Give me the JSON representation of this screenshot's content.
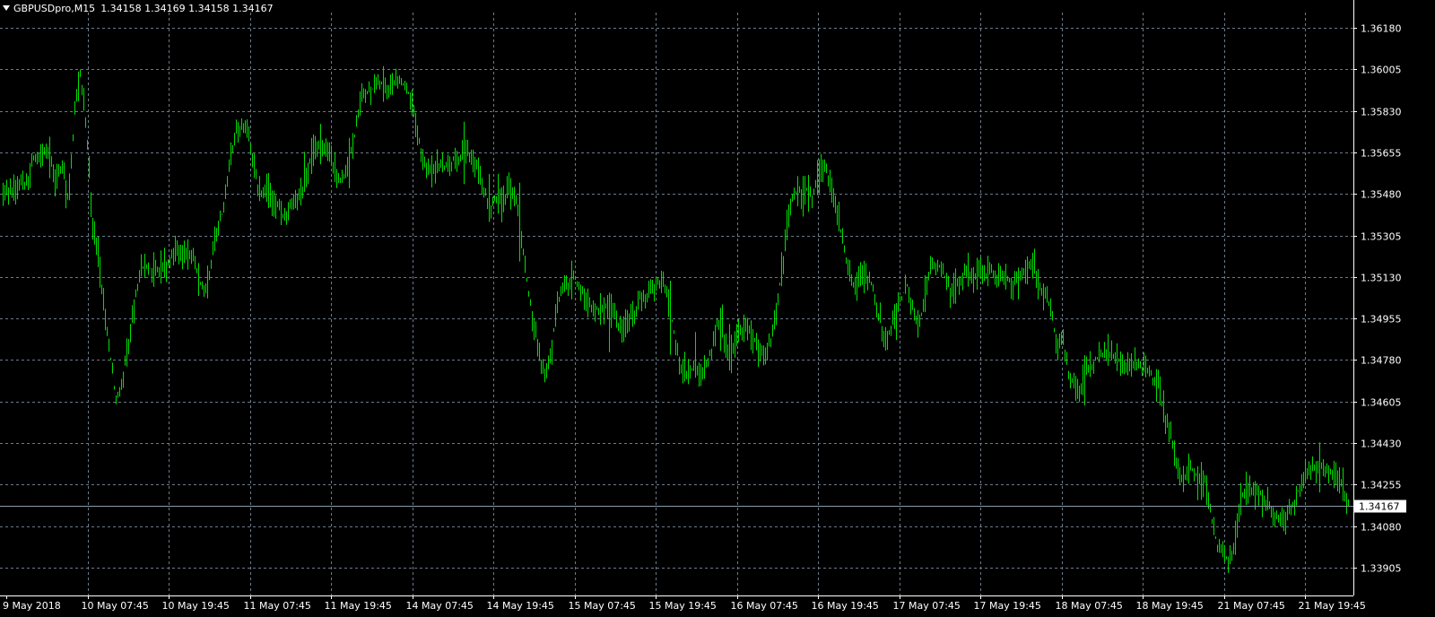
{
  "header": {
    "symbol": "GBPUSDpro,M15",
    "ohlc": "1.34158 1.34169 1.34158 1.34167"
  },
  "colors": {
    "background": "#000000",
    "grid": "#6b7a8a",
    "axis": "#ffffff",
    "bars": "#00e000",
    "bid_line": "#8a9ba8"
  },
  "chart_data": {
    "type": "bar",
    "symbol": "GBPUSDpro",
    "timeframe": "M15",
    "price_axis_labels": [
      "1.36180",
      "1.36005",
      "1.35830",
      "1.35655",
      "1.35480",
      "1.35305",
      "1.35130",
      "1.34955",
      "1.34780",
      "1.34605",
      "1.34430",
      "1.34255",
      "1.34080",
      "1.33905"
    ],
    "price_ticks": [
      1.3618,
      1.36005,
      1.3583,
      1.35655,
      1.3548,
      1.35305,
      1.3513,
      1.34955,
      1.3478,
      1.34605,
      1.3443,
      1.34255,
      1.3408,
      1.33905
    ],
    "current_price": 1.34167,
    "current_price_label": "1.34167",
    "time_axis_labels": [
      "9 May 2018",
      "10 May 07:45",
      "10 May 19:45",
      "11 May 07:45",
      "11 May 19:45",
      "14 May 07:45",
      "14 May 19:45",
      "15 May 07:45",
      "15 May 19:45",
      "16 May 07:45",
      "16 May 19:45",
      "17 May 07:45",
      "17 May 19:45",
      "18 May 07:45",
      "18 May 19:45",
      "21 May 07:45",
      "21 May 19:45"
    ],
    "ylim": [
      1.33855,
      1.36305
    ],
    "grid": true,
    "price_path": [
      [
        0,
        1.3548
      ],
      [
        1,
        1.355
      ],
      [
        2,
        1.3549
      ],
      [
        3,
        1.3553
      ],
      [
        4,
        1.3553
      ],
      [
        5,
        1.3564
      ],
      [
        6,
        1.3563
      ],
      [
        7,
        1.3566
      ],
      [
        8,
        1.3562
      ],
      [
        9,
        1.3554
      ],
      [
        10,
        1.356
      ],
      [
        11,
        1.3545
      ],
      [
        12,
        1.3582
      ],
      [
        13,
        1.36
      ],
      [
        14,
        1.3575
      ],
      [
        15,
        1.3535
      ],
      [
        16,
        1.3522
      ],
      [
        17,
        1.35
      ],
      [
        18,
        1.348
      ],
      [
        19,
        1.3461
      ],
      [
        20,
        1.347
      ],
      [
        21,
        1.3482
      ],
      [
        22,
        1.35
      ],
      [
        23,
        1.3515
      ],
      [
        24,
        1.3518
      ],
      [
        25,
        1.3516
      ],
      [
        26,
        1.3515
      ],
      [
        27,
        1.3519
      ],
      [
        28,
        1.352
      ],
      [
        29,
        1.3527
      ],
      [
        30,
        1.3524
      ],
      [
        31,
        1.3522
      ],
      [
        32,
        1.3522
      ],
      [
        33,
        1.3511
      ],
      [
        34,
        1.3507
      ],
      [
        35,
        1.352
      ],
      [
        36,
        1.3534
      ],
      [
        37,
        1.3541
      ],
      [
        38,
        1.356
      ],
      [
        39,
        1.3575
      ],
      [
        40,
        1.3577
      ],
      [
        41,
        1.3575
      ],
      [
        42,
        1.3563
      ],
      [
        43,
        1.3548
      ],
      [
        44,
        1.355
      ],
      [
        45,
        1.3546
      ],
      [
        46,
        1.3543
      ],
      [
        47,
        1.3539
      ],
      [
        48,
        1.3541
      ],
      [
        49,
        1.3545
      ],
      [
        50,
        1.3548
      ],
      [
        51,
        1.3556
      ],
      [
        52,
        1.3566
      ],
      [
        53,
        1.3569
      ],
      [
        54,
        1.3568
      ],
      [
        55,
        1.3563
      ],
      [
        56,
        1.3558
      ],
      [
        57,
        1.3553
      ],
      [
        58,
        1.356
      ],
      [
        59,
        1.3572
      ],
      [
        60,
        1.3588
      ],
      [
        61,
        1.359
      ],
      [
        62,
        1.3592
      ],
      [
        63,
        1.3595
      ],
      [
        64,
        1.3594
      ],
      [
        65,
        1.3592
      ],
      [
        66,
        1.3597
      ],
      [
        67,
        1.3595
      ],
      [
        68,
        1.3591
      ],
      [
        69,
        1.3583
      ],
      [
        70,
        1.3569
      ],
      [
        71,
        1.356
      ],
      [
        72,
        1.3557
      ],
      [
        73,
        1.356
      ],
      [
        74,
        1.356
      ],
      [
        75,
        1.356
      ],
      [
        76,
        1.3563
      ],
      [
        77,
        1.3564
      ],
      [
        78,
        1.3565
      ],
      [
        79,
        1.3563
      ],
      [
        80,
        1.3557
      ],
      [
        81,
        1.3548
      ],
      [
        82,
        1.3541
      ],
      [
        83,
        1.3548
      ],
      [
        84,
        1.3542
      ],
      [
        85,
        1.355
      ],
      [
        86,
        1.3551
      ],
      [
        87,
        1.353
      ],
      [
        88,
        1.3512
      ],
      [
        89,
        1.3495
      ],
      [
        90,
        1.348
      ],
      [
        91,
        1.347
      ],
      [
        92,
        1.348
      ],
      [
        93,
        1.35
      ],
      [
        94,
        1.3508
      ],
      [
        95,
        1.351
      ],
      [
        96,
        1.3513
      ],
      [
        97,
        1.3507
      ],
      [
        98,
        1.3503
      ],
      [
        99,
        1.3501
      ],
      [
        100,
        1.3499
      ],
      [
        101,
        1.35
      ],
      [
        102,
        1.35
      ],
      [
        103,
        1.3495
      ],
      [
        104,
        1.3491
      ],
      [
        105,
        1.3494
      ],
      [
        106,
        1.3497
      ],
      [
        107,
        1.3504
      ],
      [
        108,
        1.3505
      ],
      [
        109,
        1.3509
      ],
      [
        110,
        1.3511
      ],
      [
        111,
        1.351
      ],
      [
        112,
        1.35
      ],
      [
        113,
        1.3486
      ],
      [
        114,
        1.3474
      ],
      [
        115,
        1.3473
      ],
      [
        116,
        1.3474
      ],
      [
        117,
        1.3471
      ],
      [
        118,
        1.3475
      ],
      [
        119,
        1.3482
      ],
      [
        120,
        1.3494
      ],
      [
        121,
        1.3488
      ],
      [
        122,
        1.3477
      ],
      [
        123,
        1.3485
      ],
      [
        124,
        1.3491
      ],
      [
        125,
        1.3493
      ],
      [
        126,
        1.3487
      ],
      [
        127,
        1.3483
      ],
      [
        128,
        1.3479
      ],
      [
        129,
        1.3487
      ],
      [
        130,
        1.35
      ],
      [
        131,
        1.352
      ],
      [
        132,
        1.3541
      ],
      [
        133,
        1.3549
      ],
      [
        134,
        1.3549
      ],
      [
        135,
        1.355
      ],
      [
        136,
        1.3547
      ],
      [
        137,
        1.3557
      ],
      [
        138,
        1.3559
      ],
      [
        139,
        1.3553
      ],
      [
        140,
        1.3541
      ],
      [
        141,
        1.353
      ],
      [
        142,
        1.3516
      ],
      [
        143,
        1.3509
      ],
      [
        144,
        1.3512
      ],
      [
        145,
        1.3514
      ],
      [
        146,
        1.351
      ],
      [
        147,
        1.3498
      ],
      [
        148,
        1.3486
      ],
      [
        149,
        1.349
      ],
      [
        150,
        1.3498
      ],
      [
        151,
        1.3505
      ],
      [
        152,
        1.351
      ],
      [
        153,
        1.3497
      ],
      [
        154,
        1.3493
      ],
      [
        155,
        1.3508
      ],
      [
        156,
        1.3517
      ],
      [
        157,
        1.3519
      ],
      [
        158,
        1.3514
      ],
      [
        159,
        1.3508
      ],
      [
        160,
        1.3509
      ],
      [
        161,
        1.3513
      ],
      [
        162,
        1.3516
      ],
      [
        163,
        1.3514
      ],
      [
        164,
        1.3515
      ],
      [
        165,
        1.3514
      ],
      [
        166,
        1.3515
      ],
      [
        167,
        1.3512
      ],
      [
        168,
        1.3515
      ],
      [
        169,
        1.3512
      ],
      [
        170,
        1.351
      ],
      [
        171,
        1.3513
      ],
      [
        172,
        1.3515
      ],
      [
        173,
        1.3519
      ],
      [
        174,
        1.3508
      ],
      [
        175,
        1.3505
      ],
      [
        176,
        1.35
      ],
      [
        177,
        1.3485
      ],
      [
        178,
        1.3486
      ],
      [
        179,
        1.3473
      ],
      [
        180,
        1.3467
      ],
      [
        181,
        1.3465
      ],
      [
        182,
        1.3474
      ],
      [
        183,
        1.3476
      ],
      [
        184,
        1.348
      ],
      [
        185,
        1.3481
      ],
      [
        186,
        1.348
      ],
      [
        187,
        1.348
      ],
      [
        188,
        1.3477
      ],
      [
        189,
        1.3476
      ],
      [
        190,
        1.3476
      ],
      [
        191,
        1.3475
      ],
      [
        192,
        1.3474
      ],
      [
        193,
        1.3471
      ],
      [
        194,
        1.3468
      ],
      [
        195,
        1.3457
      ],
      [
        196,
        1.3448
      ],
      [
        197,
        1.3435
      ],
      [
        198,
        1.3427
      ],
      [
        199,
        1.3432
      ],
      [
        200,
        1.3431
      ],
      [
        201,
        1.3428
      ],
      [
        202,
        1.3426
      ],
      [
        203,
        1.3412
      ],
      [
        204,
        1.34
      ],
      [
        205,
        1.3397
      ],
      [
        206,
        1.3392
      ],
      [
        207,
        1.3402
      ],
      [
        208,
        1.342
      ],
      [
        209,
        1.3425
      ],
      [
        210,
        1.3424
      ],
      [
        211,
        1.3422
      ],
      [
        212,
        1.3419
      ],
      [
        213,
        1.3414
      ],
      [
        214,
        1.3412
      ],
      [
        215,
        1.341
      ],
      [
        216,
        1.3414
      ],
      [
        217,
        1.3419
      ],
      [
        218,
        1.3426
      ],
      [
        219,
        1.343
      ],
      [
        220,
        1.3432
      ],
      [
        221,
        1.3433
      ],
      [
        222,
        1.3433
      ],
      [
        223,
        1.343
      ],
      [
        224,
        1.343
      ],
      [
        225,
        1.3424
      ],
      [
        226,
        1.3417
      ]
    ]
  }
}
